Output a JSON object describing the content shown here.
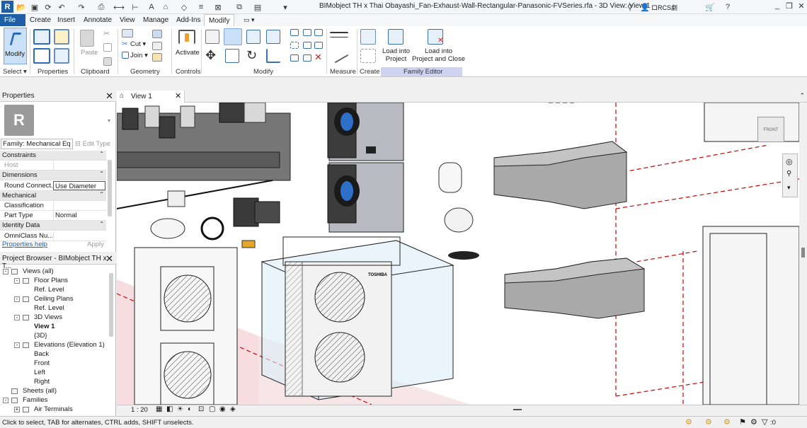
{
  "titlebar": {
    "doc_title": "BIMobject TH x Thai Obayashi_Fan-Exhaust-Wall-Rectangular-Panasonic-FVSeries.rfa - 3D View: View 1",
    "user": "ロRCS劇"
  },
  "tabs": [
    "File",
    "Create",
    "Insert",
    "Annotate",
    "View",
    "Manage",
    "Add-Ins",
    "Modify"
  ],
  "ribbon": {
    "modify_label": "Modify",
    "paste_label": "Paste",
    "cut_label": "Cut",
    "join_label": "Join",
    "activate_label": "Activate",
    "load_into_project": "Load into\nProject",
    "load_into_project_close": "Load into\nProject and Close",
    "panels": {
      "select": "Select",
      "properties": "Properties",
      "clipboard": "Clipboard",
      "geometry": "Geometry",
      "controls": "Controls",
      "modify": "Modify",
      "measure": "Measure",
      "create": "Create",
      "family_editor": "Family Editor"
    }
  },
  "properties": {
    "title": "Properties",
    "type_selector": "Family: Mechanical Eq",
    "edit_type": "Edit Type",
    "rows": [
      {
        "k": "Constraints",
        "v": "",
        "group": true
      },
      {
        "k": "Host",
        "v": "",
        "group": false
      },
      {
        "k": "Dimensions",
        "v": "",
        "group": true
      },
      {
        "k": "Round Connect...",
        "v": "Use Diameter",
        "group": false
      },
      {
        "k": "Mechanical",
        "v": "",
        "group": true
      },
      {
        "k": "Classification",
        "v": "",
        "group": false
      },
      {
        "k": "Part Type",
        "v": "Normal",
        "group": false
      },
      {
        "k": "Identity Data",
        "v": "",
        "group": true
      },
      {
        "k": "OmniClass Nu...",
        "v": "",
        "group": false
      }
    ],
    "help_link": "Properties help",
    "apply": "Apply"
  },
  "browser": {
    "title": "Project Browser - BIMobject TH x T...",
    "nodes": [
      {
        "label": "Views (all)",
        "indent": 0,
        "toggle": "-",
        "bold": false
      },
      {
        "label": "Floor Plans",
        "indent": 1,
        "toggle": "-",
        "bold": false
      },
      {
        "label": "Ref. Level",
        "indent": 2,
        "toggle": "",
        "bold": false
      },
      {
        "label": "Ceiling Plans",
        "indent": 1,
        "toggle": "-",
        "bold": false
      },
      {
        "label": "Ref. Level",
        "indent": 2,
        "toggle": "",
        "bold": false
      },
      {
        "label": "3D Views",
        "indent": 1,
        "toggle": "-",
        "bold": false
      },
      {
        "label": "View 1",
        "indent": 2,
        "toggle": "",
        "bold": true
      },
      {
        "label": "{3D}",
        "indent": 2,
        "toggle": "",
        "bold": false
      },
      {
        "label": "Elevations (Elevation 1)",
        "indent": 1,
        "toggle": "-",
        "bold": false
      },
      {
        "label": "Back",
        "indent": 2,
        "toggle": "",
        "bold": false
      },
      {
        "label": "Front",
        "indent": 2,
        "toggle": "",
        "bold": false
      },
      {
        "label": "Left",
        "indent": 2,
        "toggle": "",
        "bold": false
      },
      {
        "label": "Right",
        "indent": 2,
        "toggle": "",
        "bold": false
      },
      {
        "label": "Sheets (all)",
        "indent": 0,
        "toggle": "",
        "bold": false
      },
      {
        "label": "Families",
        "indent": 0,
        "toggle": "-",
        "bold": false
      },
      {
        "label": "Air Terminals",
        "indent": 1,
        "toggle": "+",
        "bold": false
      }
    ]
  },
  "view": {
    "tab_label": "View 1",
    "scale": "1 : 20",
    "viewcube_label": "FRONT",
    "unit_brand": "TOSHIBA"
  },
  "status": {
    "message": "Click to select, TAB for alternates, CTRL adds, SHIFT unselects.",
    "filter_count": ":0"
  },
  "colors": {
    "file_tab": "#1f5fa8",
    "family_editor_band": "#cfd3f0",
    "selection_box": "#9ac8e6",
    "reference_plane": "#d20000"
  }
}
